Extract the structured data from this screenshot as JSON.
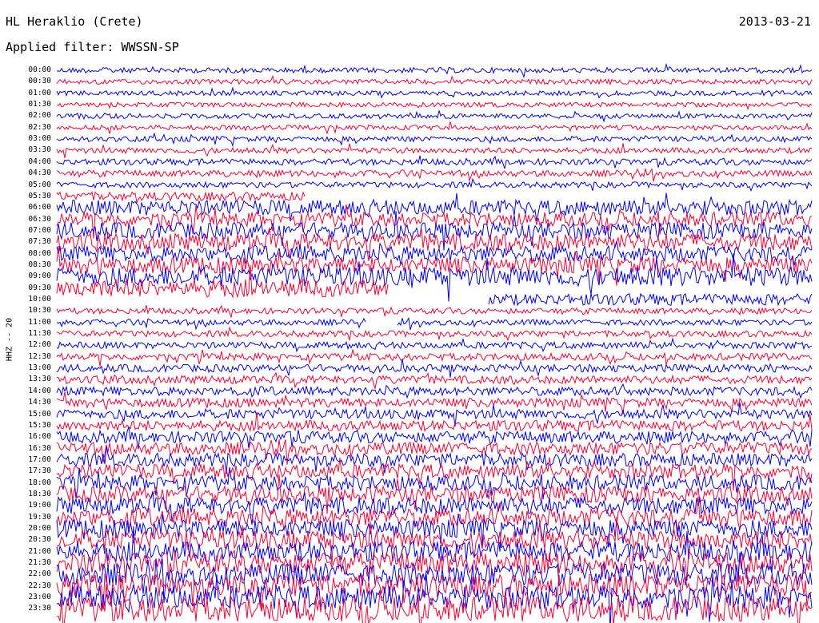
{
  "header": {
    "station": "HL Heraklio (Crete)",
    "date": "2013-03-21",
    "filter": "Applied filter: WWSSN-SP",
    "channel": "HHZ -- 20"
  },
  "colors": {
    "trace_a": "#0000ff",
    "trace_b": "#ff0033",
    "background": "#ffffff",
    "text": "#000000"
  },
  "chart_data": {
    "type": "line",
    "title": "HL Heraklio (Crete)",
    "ylabel": "HHZ -- 20",
    "xlabel": "",
    "row_labels": [
      "00:00",
      "00:30",
      "01:00",
      "01:30",
      "02:00",
      "02:30",
      "03:00",
      "03:30",
      "04:00",
      "04:30",
      "05:00",
      "05:30",
      "06:00",
      "06:30",
      "07:00",
      "07:30",
      "08:00",
      "08:30",
      "09:00",
      "09:30",
      "10:00",
      "10:30",
      "11:00",
      "11:30",
      "12:00",
      "12:30",
      "13:00",
      "13:30",
      "14:00",
      "14:30",
      "15:00",
      "15:30",
      "16:00",
      "16:30",
      "17:00",
      "17:30",
      "18:00",
      "18:30",
      "19:00",
      "19:30",
      "20:00",
      "20:30",
      "21:00",
      "21:30",
      "22:00",
      "22:30",
      "23:00",
      "23:30"
    ],
    "row_color_cycle": [
      "blue",
      "red"
    ],
    "relative_amplitude": [
      0.55,
      0.5,
      0.5,
      0.5,
      0.5,
      0.5,
      0.55,
      0.6,
      0.65,
      0.65,
      0.6,
      0.9,
      1.6,
      1.5,
      1.7,
      1.8,
      1.6,
      1.7,
      2.0,
      1.9,
      1.2,
      0.6,
      0.6,
      0.65,
      0.7,
      0.75,
      0.8,
      0.85,
      0.9,
      0.95,
      1.0,
      1.1,
      1.2,
      1.3,
      1.4,
      1.5,
      1.6,
      1.7,
      1.8,
      1.85,
      1.9,
      2.0,
      2.1,
      2.2,
      2.3,
      2.4,
      2.5,
      2.6
    ],
    "gaps": [
      {
        "row": "05:30",
        "from_fraction": 0.33,
        "to_fraction": 1.0
      },
      {
        "row": "09:30",
        "from_fraction": 0.44,
        "to_fraction": 1.0
      },
      {
        "row": "10:00",
        "from_fraction": 0.0,
        "to_fraction": 0.57
      },
      {
        "row": "11:00",
        "from_fraction": 0.41,
        "to_fraction": 0.45
      }
    ]
  }
}
